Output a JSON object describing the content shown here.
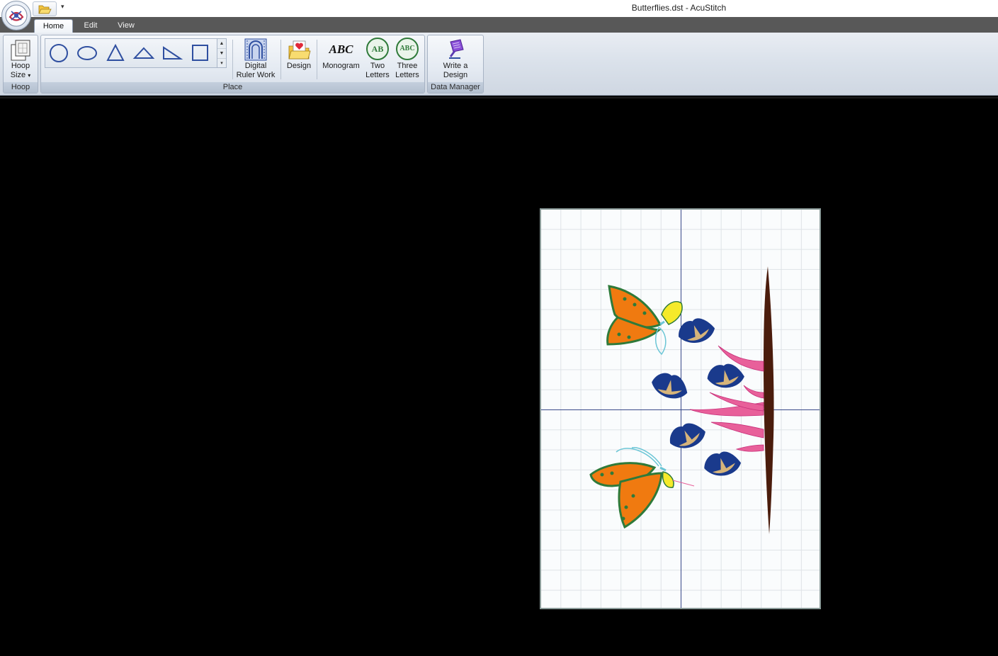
{
  "window": {
    "title": "Butterflies.dst - AcuStitch"
  },
  "tabs": [
    {
      "label": "Home",
      "active": true
    },
    {
      "label": "Edit",
      "active": false
    },
    {
      "label": "View",
      "active": false
    }
  ],
  "ribbon": {
    "groups": {
      "hoop": "Hoop",
      "place": "Place",
      "data_manager": "Data Manager"
    },
    "hoop_size": {
      "line1": "Hoop",
      "line2": "Size"
    },
    "gallery_shapes": [
      "circle",
      "ellipse",
      "triangle",
      "wide-triangle",
      "right-triangle",
      "square"
    ],
    "digital_ruler": {
      "line1": "Digital",
      "line2": "Ruler Work"
    },
    "design": "Design",
    "monogram": "Monogram",
    "two_letters": {
      "line1": "Two",
      "line2": "Letters"
    },
    "three_letters": {
      "line1": "Three",
      "line2": "Letters"
    },
    "write_design": {
      "line1": "Write a",
      "line2": "Design"
    }
  },
  "icons": {
    "app": "app-orb-icon",
    "open": "folder-open-icon",
    "monogram_text": "ABC",
    "two_text": "AB",
    "three_text": "ABC"
  },
  "colors": {
    "accent_blue": "#2f4fa0",
    "orange": "#f07a10",
    "green": "#2f7a3a",
    "navy": "#1a3a8c",
    "tan": "#d6b47a",
    "pink": "#e8609a",
    "brown": "#4a1c0c",
    "yellow": "#f5ea2a",
    "cyan": "#6cc6d6"
  }
}
